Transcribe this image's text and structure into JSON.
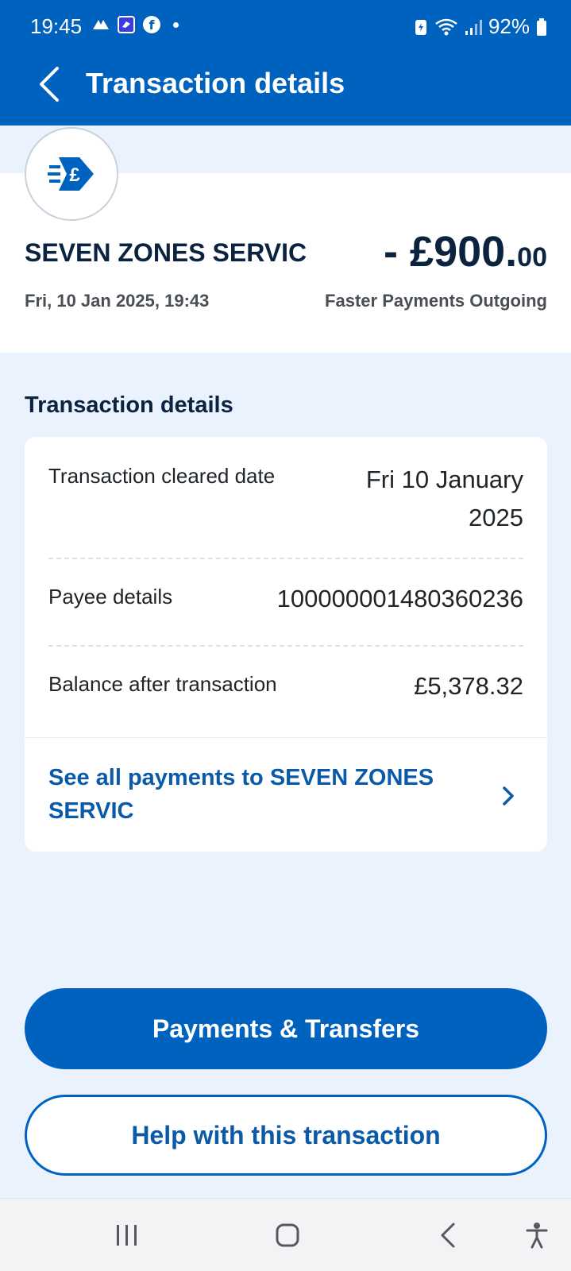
{
  "status_bar": {
    "time": "19:45",
    "battery": "92%",
    "notification_icons": [
      "halifax-icon",
      "app-icon",
      "facebook-icon",
      "dot-icon"
    ],
    "system_icons": [
      "battery-saver-icon",
      "wifi-icon",
      "signal-icon",
      "battery-icon"
    ]
  },
  "header": {
    "title": "Transaction details",
    "back_icon": "chevron-left-icon"
  },
  "transaction": {
    "merchant_icon": "faster-payment-pound-icon",
    "merchant": "SEVEN ZONES SERVIC",
    "date": "Fri, 10 Jan 2025, 19:43",
    "amount_main": "- £900.",
    "amount_decimal": "00",
    "type": "Faster Payments Outgoing"
  },
  "details": {
    "section_title": "Transaction details",
    "rows": [
      {
        "label": "Transaction cleared date",
        "value": "Fri 10 January 2025"
      },
      {
        "label": "Payee details",
        "value": "100000001480360236"
      },
      {
        "label": "Balance after transaction",
        "value": "£5,378.32"
      }
    ],
    "see_all_link": "See all payments to SEVEN ZONES SERVIC"
  },
  "buttons": {
    "primary": "Payments & Transfers",
    "secondary": "Help with this transaction"
  },
  "nav_bar": {
    "icons": [
      "recent-apps-icon",
      "home-icon",
      "back-icon",
      "accessibility-icon"
    ]
  },
  "colors": {
    "brand_blue": "#0062bf",
    "link_blue": "#0a5aa8",
    "page_bg": "#eaf3fd",
    "text_dark": "#0c2340"
  }
}
